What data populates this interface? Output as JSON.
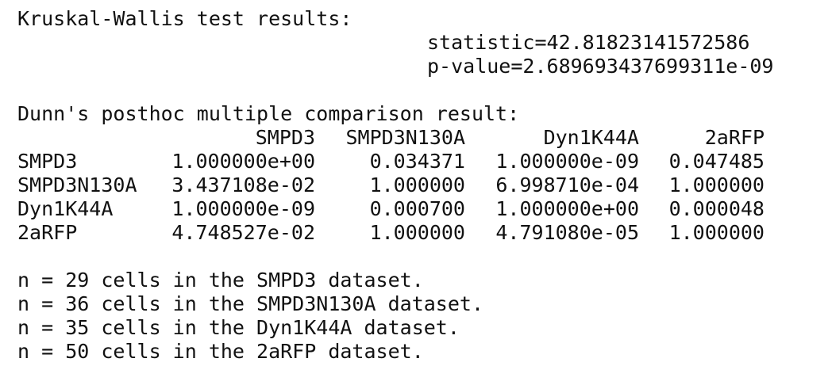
{
  "kruskal": {
    "title": "Kruskal-Wallis test results:",
    "statistic": "statistic=42.81823141572586",
    "pvalue": "p-value=2.689693437699311e-09"
  },
  "dunn": {
    "title": "Dunn's posthoc multiple comparison result:",
    "columns": [
      "SMPD3",
      "SMPD3N130A",
      "Dyn1K44A",
      "2aRFP"
    ],
    "rows": [
      {
        "name": "SMPD3",
        "values": [
          "1.000000e+00",
          "0.034371",
          "1.000000e-09",
          "0.047485"
        ]
      },
      {
        "name": "SMPD3N130A",
        "values": [
          "3.437108e-02",
          "1.000000",
          "6.998710e-04",
          "1.000000"
        ]
      },
      {
        "name": "Dyn1K44A",
        "values": [
          "1.000000e-09",
          "0.000700",
          "1.000000e+00",
          "0.000048"
        ]
      },
      {
        "name": "2aRFP",
        "values": [
          "4.748527e-02",
          "1.000000",
          "4.791080e-05",
          "1.000000"
        ]
      }
    ]
  },
  "counts": [
    "n = 29 cells in the SMPD3 dataset.",
    "n = 36 cells in the SMPD3N130A dataset.",
    "n = 35 cells in the Dyn1K44A dataset.",
    "n = 50 cells in the 2aRFP dataset."
  ]
}
